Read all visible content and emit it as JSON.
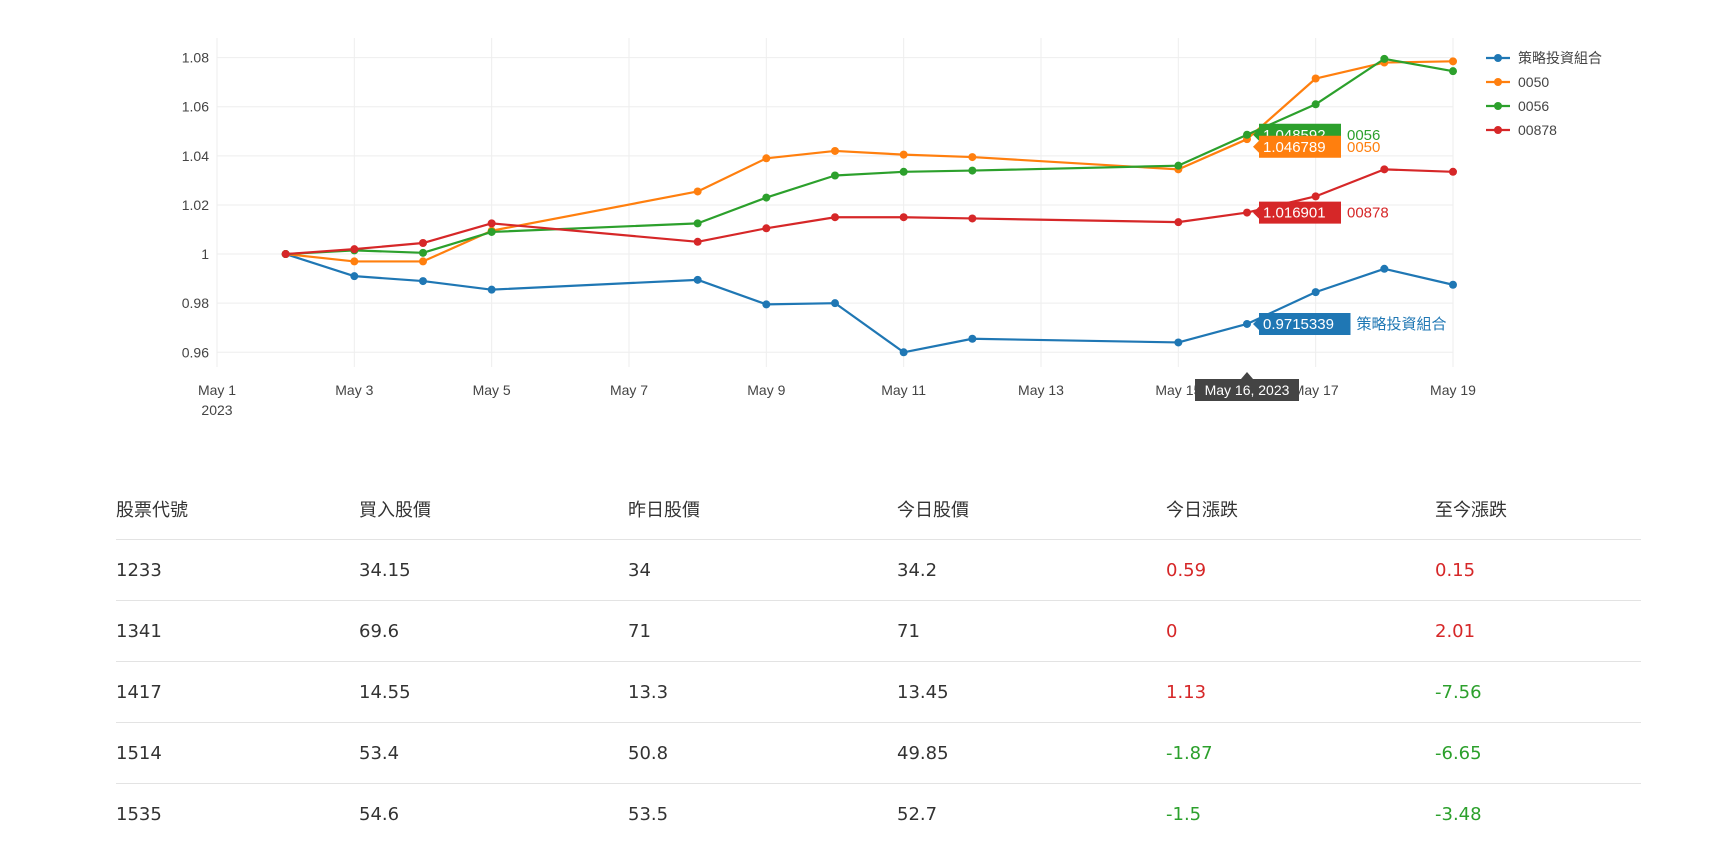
{
  "chart_data": {
    "type": "line",
    "x": [
      "2023-05-02",
      "2023-05-03",
      "2023-05-04",
      "2023-05-05",
      "2023-05-08",
      "2023-05-09",
      "2023-05-10",
      "2023-05-11",
      "2023-05-12",
      "2023-05-15",
      "2023-05-16",
      "2023-05-17",
      "2023-05-18",
      "2023-05-19"
    ],
    "series": [
      {
        "name": "策略投資組合",
        "color": "#1f77b4",
        "values": [
          1.0,
          0.991,
          0.989,
          0.9855,
          0.9895,
          0.9795,
          0.98,
          0.96,
          0.9655,
          0.964,
          0.9715339,
          0.9845,
          0.994,
          0.9875
        ]
      },
      {
        "name": "0050",
        "color": "#ff7f0e",
        "values": [
          1.0,
          0.997,
          0.997,
          1.0095,
          1.0255,
          1.039,
          1.042,
          1.0405,
          1.0395,
          1.0345,
          1.046789,
          1.0715,
          1.078,
          1.0785
        ]
      },
      {
        "name": "0056",
        "color": "#2ca02c",
        "values": [
          1.0,
          1.0015,
          1.0005,
          1.009,
          1.0125,
          1.023,
          1.032,
          1.0335,
          1.034,
          1.036,
          1.048592,
          1.061,
          1.0795,
          1.0745
        ]
      },
      {
        "name": "00878",
        "color": "#d62728",
        "values": [
          1.0,
          1.002,
          1.0045,
          1.0125,
          1.005,
          1.0105,
          1.015,
          1.015,
          1.0145,
          1.013,
          1.016901,
          1.0235,
          1.0345,
          1.0335
        ]
      }
    ],
    "x_ticks": [
      "May 1",
      "May 3",
      "May 5",
      "May 7",
      "May 9",
      "May 11",
      "May 13",
      "May 15",
      "May 17",
      "May 19"
    ],
    "x_tick_values": [
      "2023-05-01",
      "2023-05-03",
      "2023-05-05",
      "2023-05-07",
      "2023-05-09",
      "2023-05-11",
      "2023-05-13",
      "2023-05-15",
      "2023-05-17",
      "2023-05-19"
    ],
    "x_first_tick_sublabel": "2023",
    "y_ticks": [
      "0.96",
      "0.98",
      "1",
      "1.02",
      "1.04",
      "1.06",
      "1.08"
    ],
    "y_tick_values": [
      0.96,
      0.98,
      1.0,
      1.02,
      1.04,
      1.06,
      1.08
    ],
    "xlim": [
      "2023-05-01",
      "2023-05-19"
    ],
    "ylim": [
      0.954,
      1.088
    ],
    "grid": true,
    "legend_position": "top-right",
    "hover": {
      "x_label": "May 16, 2023",
      "x_value": "2023-05-16",
      "labels": [
        {
          "series": "0056",
          "value_text": "1.048592"
        },
        {
          "series": "0050",
          "value_text": "1.046789"
        },
        {
          "series": "00878",
          "value_text": "1.016901"
        },
        {
          "series": "策略投資組合",
          "value_text": "0.9715339"
        }
      ]
    }
  },
  "table": {
    "headers": [
      "股票代號",
      "買入股價",
      "昨日股價",
      "今日股價",
      "今日漲跌",
      "至今漲跌"
    ],
    "rows": [
      [
        "1233",
        "34.15",
        "34",
        "34.2",
        "0.59",
        "0.15"
      ],
      [
        "1341",
        "69.6",
        "71",
        "71",
        "0",
        "2.01"
      ],
      [
        "1417",
        "14.55",
        "13.3",
        "13.45",
        "1.13",
        "-7.56"
      ],
      [
        "1514",
        "53.4",
        "50.8",
        "49.85",
        "-1.87",
        "-6.65"
      ],
      [
        "1535",
        "54.6",
        "53.5",
        "52.7",
        "-1.5",
        "-3.48"
      ]
    ],
    "colors": {
      "up": "#d62728",
      "down": "#2ca02c",
      "text": "#333333"
    }
  }
}
